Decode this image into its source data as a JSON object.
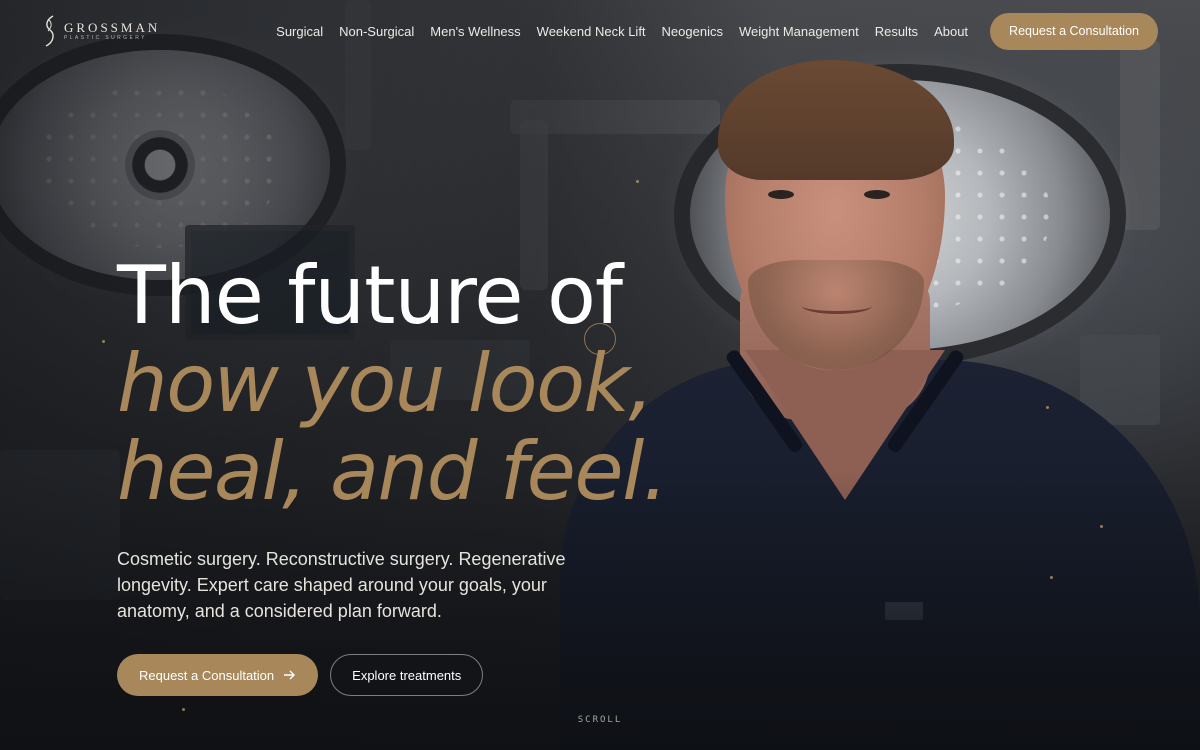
{
  "brand": {
    "name": "GROSSMAN",
    "tagline": "PLASTIC SURGERY",
    "accent_color": "#a8875a"
  },
  "nav": {
    "items": [
      {
        "label": "Surgical"
      },
      {
        "label": "Non-Surgical"
      },
      {
        "label": "Men's Wellness"
      },
      {
        "label": "Weekend Neck Lift"
      },
      {
        "label": "Neogenics"
      },
      {
        "label": "Weight Management"
      },
      {
        "label": "Results"
      },
      {
        "label": "About"
      }
    ],
    "cta_label": "Request a Consultation"
  },
  "hero": {
    "line1": "The future of",
    "line2": "how you look,",
    "line3": "heal, and feel.",
    "lede": "Cosmetic surgery. Reconstructive surgery. Regenerative longevity. Expert care shaped around your goals, your anatomy, and a considered plan forward.",
    "primary_cta": "Request a Consultation",
    "primary_cta_icon": "arrow-right-icon",
    "secondary_cta": "Explore treatments"
  },
  "scroll_label": "SCROLL"
}
